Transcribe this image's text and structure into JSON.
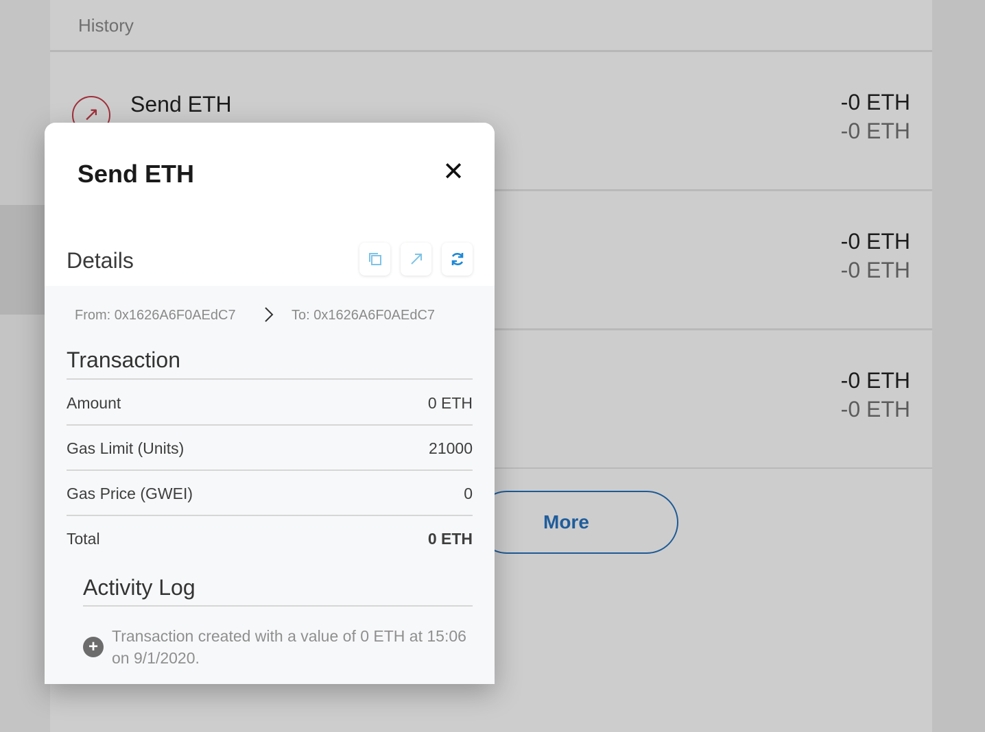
{
  "history": {
    "title": "History",
    "rows": [
      {
        "name": "Send ETH",
        "amount_primary": "-0 ETH",
        "amount_secondary": "-0 ETH"
      },
      {
        "name": "",
        "amount_primary": "-0 ETH",
        "amount_secondary": "-0 ETH"
      },
      {
        "name": "",
        "amount_primary": "-0 ETH",
        "amount_secondary": "-0 ETH"
      }
    ],
    "more_label": "More"
  },
  "modal": {
    "title": "Send ETH",
    "details_title": "Details",
    "icons": {
      "close": "close-icon",
      "copy": "copy-icon",
      "open": "external-link-icon",
      "refresh": "refresh-icon"
    },
    "from": "From: 0x1626A6F0AEdC7",
    "to": "To: 0x1626A6F0AEdC7",
    "transaction_title": "Transaction",
    "rows": [
      {
        "label": "Amount",
        "value": "0 ETH"
      },
      {
        "label": "Gas Limit (Units)",
        "value": "21000"
      },
      {
        "label": "Gas Price (GWEI)",
        "value": "0"
      },
      {
        "label": "Total",
        "value": "0 ETH"
      }
    ],
    "activity_title": "Activity Log",
    "activity_entries": [
      {
        "text": "Transaction created with a value of 0 ETH at 15:06 on 9/1/2020."
      }
    ]
  },
  "colors": {
    "accent_blue": "#1f5d9c",
    "send_red": "#a0303b",
    "icon_light_blue": "#7ec3e6",
    "icon_blue": "#1e88d6"
  }
}
